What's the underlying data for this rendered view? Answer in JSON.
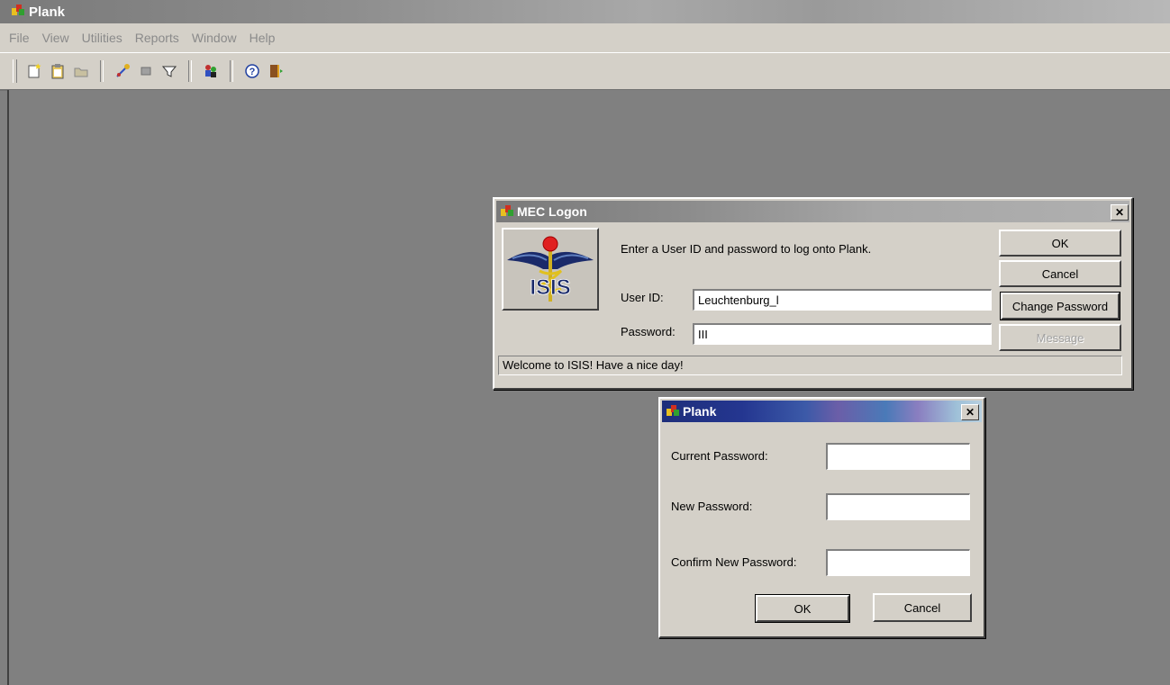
{
  "app": {
    "title": "Plank"
  },
  "menu": [
    "File",
    "View",
    "Utilities",
    "Reports",
    "Window",
    "Help"
  ],
  "toolbar": {
    "buttons": [
      "new-document-icon",
      "clipboard-icon",
      "folder-icon",
      "connect-icon",
      "record-icon",
      "filter-icon",
      "people-icon",
      "help-icon",
      "exit-door-icon"
    ]
  },
  "logon": {
    "title": "MEC Logon",
    "logo_text": "ISIS",
    "instruction": "Enter a User ID and password to log onto Plank.",
    "user_id_label": "User ID:",
    "user_id_value": "Leuchtenburg_l",
    "password_label": "Password:",
    "password_value": "III",
    "ok_label": "OK",
    "cancel_label": "Cancel",
    "change_password_label": "Change Password",
    "message_label": "Message",
    "status": "Welcome to ISIS! Have a nice day!"
  },
  "change_password": {
    "title": "Plank",
    "current_label": "Current Password:",
    "new_label": "New Password:",
    "confirm_label": "Confirm New Password:",
    "current_value": "",
    "new_value": "",
    "confirm_value": "",
    "ok_label": "OK",
    "cancel_label": "Cancel"
  },
  "colors": {
    "workspace": "#808080",
    "chrome": "#d4d0c8",
    "dialog_title_blue": "#1e2e7a"
  }
}
